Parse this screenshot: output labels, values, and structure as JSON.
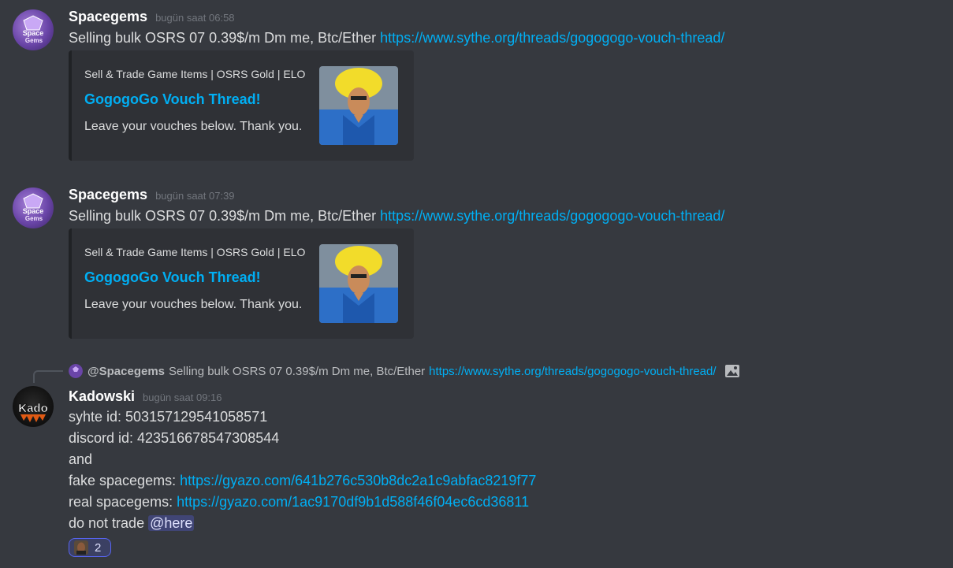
{
  "messages": [
    {
      "author": "Spacegems",
      "timestamp": "bugün saat 06:58",
      "text_prefix": "Selling bulk OSRS 07 0.39$/m Dm me, Btc/Ether ",
      "link": "https://www.sythe.org/threads/gogogogo-vouch-thread/",
      "embed": {
        "provider": "Sell & Trade Game Items | OSRS Gold | ELO",
        "title": "GogogoGo Vouch Thread!",
        "description": "Leave your vouches below. Thank you."
      }
    },
    {
      "author": "Spacegems",
      "timestamp": "bugün saat 07:39",
      "text_prefix": "Selling bulk OSRS 07 0.39$/m Dm me, Btc/Ether ",
      "link": "https://www.sythe.org/threads/gogogogo-vouch-thread/",
      "embed": {
        "provider": "Sell & Trade Game Items | OSRS Gold | ELO",
        "title": "GogogoGo Vouch Thread!",
        "description": "Leave your vouches below. Thank you."
      }
    }
  ],
  "reply": {
    "author": "@Spacegems",
    "text": "Selling bulk OSRS 07 0.39$/m Dm me, Btc/Ether",
    "link": "https://www.sythe.org/threads/gogogogo-vouch-thread/",
    "icon": "image-icon"
  },
  "kado": {
    "author": "Kadowski",
    "timestamp": "bugün saat 09:16",
    "avatar_text": "Kado",
    "line1": "syhte id: 503157129541058571",
    "line2": "discord id: 423516678547308544",
    "line3": "and",
    "line4_label": "fake spacegems: ",
    "line4_link": "https://gyazo.com/641b276c530b8dc2a1c9abfac8219f77",
    "line5_label": "real spacegems: ",
    "line5_link": "https://gyazo.com/1ac9170df9b1d588f46f04ec6cd36811",
    "line6_label": "do not trade ",
    "mention": "@here",
    "reaction_count": "2"
  },
  "avatar_labels": {
    "space_line1": "Space",
    "space_line2": "Gems"
  },
  "colors": {
    "background": "#36393f",
    "link": "#00aff4",
    "embed_bg": "#2f3136",
    "mention_bg": "#414675"
  }
}
